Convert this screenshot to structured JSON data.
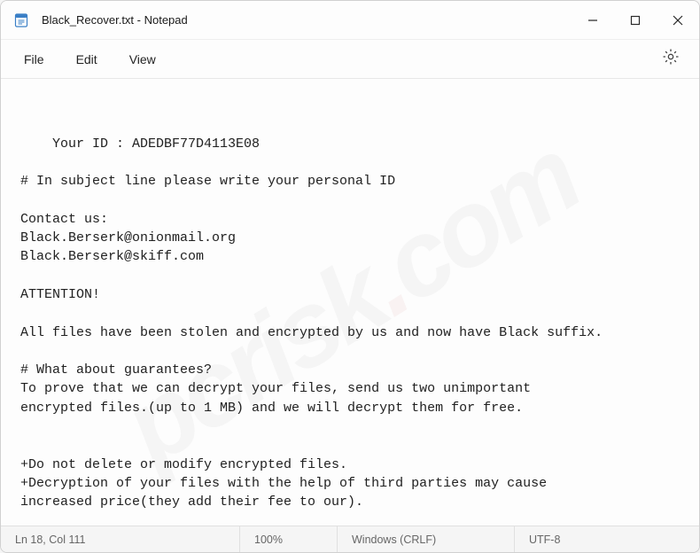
{
  "window": {
    "title": "Black_Recover.txt - Notepad"
  },
  "menu": {
    "file": "File",
    "edit": "Edit",
    "view": "View"
  },
  "document": {
    "text": "Your ID : ADEDBF77D4113E08\n\n# In subject line please write your personal ID\n\nContact us:\nBlack.Berserk@onionmail.org\nBlack.Berserk@skiff.com\n\nATTENTION!\n\nAll files have been stolen and encrypted by us and now have Black suffix.\n\n# What about guarantees?\nTo prove that we can decrypt your files, send us two unimportant\nencrypted files.(up to 1 MB) and we will decrypt them for free.\n\n\n+Do not delete or modify encrypted files.\n+Decryption of your files with the help of third parties may cause\nincreased price(they add their fee to our)."
  },
  "status": {
    "position": "Ln 18, Col 111",
    "zoom": "100%",
    "line_ending": "Windows (CRLF)",
    "encoding": "UTF-8"
  }
}
